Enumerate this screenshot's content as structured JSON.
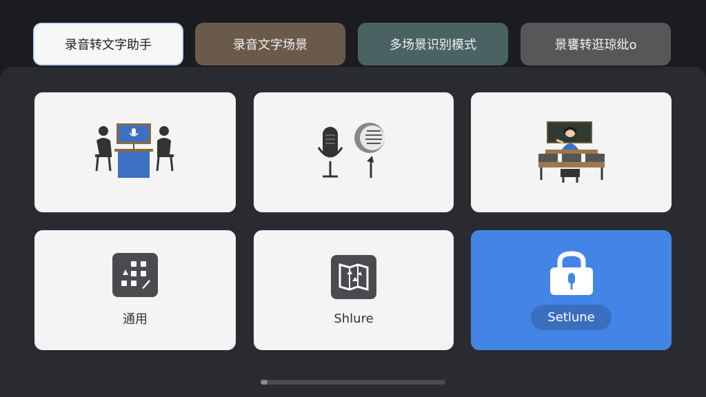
{
  "tabs": [
    {
      "label": "录音转文字助手",
      "selected": true
    },
    {
      "label": "录音文字场景",
      "selected": false
    },
    {
      "label": "多场景识别模式",
      "selected": false
    },
    {
      "label": "景饔转逛琼纰o",
      "selected": false
    }
  ],
  "cards": [
    {
      "icon": "meeting-icon",
      "label": ""
    },
    {
      "icon": "microphone-icon",
      "label": ""
    },
    {
      "icon": "classroom-icon",
      "label": ""
    },
    {
      "icon": "grid-apps-icon",
      "label": "通用"
    },
    {
      "icon": "map-share-icon",
      "label": "Shlure"
    },
    {
      "icon": "lock-mic-icon",
      "label": "Setlune",
      "selected": true
    }
  ],
  "colors": {
    "background": "#1b1c20",
    "panel": "#2a2b30",
    "card": "#f4f4f4",
    "accent": "#4385e6"
  }
}
